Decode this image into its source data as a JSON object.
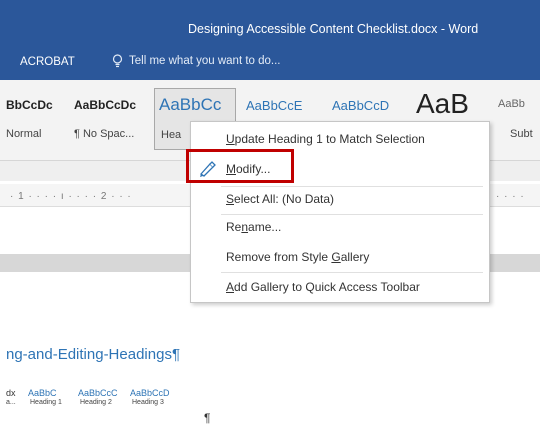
{
  "window": {
    "title": "Designing Accessible Content Checklist.docx - Word"
  },
  "ribbon": {
    "tabs": [
      {
        "label": "ACROBAT"
      }
    ],
    "tell_me": {
      "icon": "lightbulb-icon",
      "placeholder": "Tell me what you want to do..."
    },
    "style_gallery": [
      {
        "preview": "BbCcDc",
        "name": "Normal"
      },
      {
        "preview": "AaBbCcDc",
        "name": "¶ No Spac..."
      },
      {
        "preview": "AaBbCc",
        "name": "Hea",
        "selected": true
      },
      {
        "preview": "AaBbCcE",
        "name": ""
      },
      {
        "preview": "AaBbCcD",
        "name": ""
      },
      {
        "preview": "AaB",
        "name": ""
      },
      {
        "preview": "AaBb",
        "name": "Subt"
      }
    ]
  },
  "ruler": {
    "ticks": "· 1 · · · · ı · · · · 2 · · ·",
    "ticks_right": "· · · ·"
  },
  "context_menu": {
    "items": [
      {
        "label": "Update Heading 1 to Match Selection",
        "underline_char": "U"
      },
      {
        "label": "Modify...",
        "underline_char": "M",
        "icon": "modify-style-icon",
        "highlighted": true
      },
      {
        "label": "Select All: (No Data)",
        "underline_char": "S"
      },
      {
        "label": "Rename...",
        "underline_char": "n"
      },
      {
        "label": "Remove from Style Gallery",
        "underline_char": "G"
      },
      {
        "label": "Add Gallery to Quick Access Toolbar",
        "underline_char": "A"
      }
    ],
    "highlight_color": "#c00000"
  },
  "document": {
    "heading": "ng-and-Editing-Headings¶",
    "heading_color": "#2e74b5",
    "mini_gallery": [
      {
        "preview": "dx",
        "name": "a..."
      },
      {
        "preview": "AaBbC",
        "name": "Heading 1"
      },
      {
        "preview": "AaBbCcC",
        "name": "Heading 2"
      },
      {
        "preview": "AaBbCcD",
        "name": "Heading 3"
      }
    ],
    "pilcrow": "¶"
  },
  "colors": {
    "titlebar": "#2b579a",
    "accent_blue": "#2e74b5"
  }
}
